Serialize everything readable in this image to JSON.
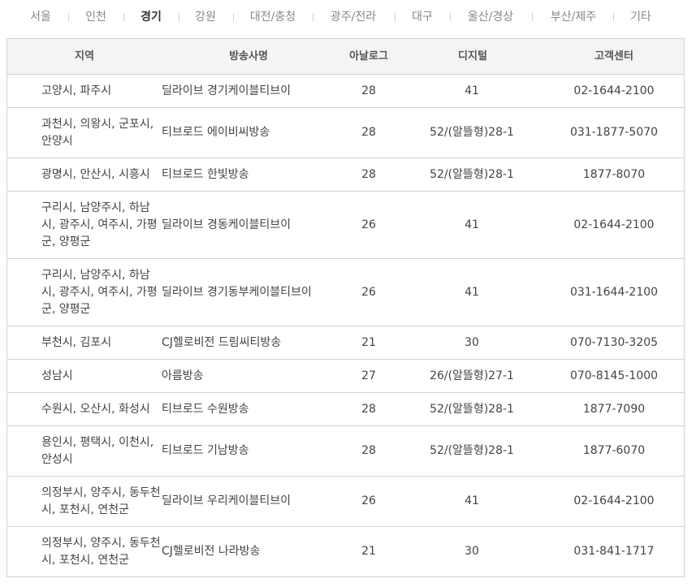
{
  "tabs": [
    {
      "label": "서울",
      "active": false
    },
    {
      "label": "인천",
      "active": false
    },
    {
      "label": "경기",
      "active": true
    },
    {
      "label": "강원",
      "active": false
    },
    {
      "label": "대전/충청",
      "active": false
    },
    {
      "label": "광주/전라",
      "active": false
    },
    {
      "label": "대구",
      "active": false
    },
    {
      "label": "울산/경상",
      "active": false
    },
    {
      "label": "부산/제주",
      "active": false
    },
    {
      "label": "기타",
      "active": false
    }
  ],
  "table": {
    "headers": {
      "region": "지역",
      "broadcaster": "방송사명",
      "analog": "아날로그",
      "digital": "디지털",
      "service_center": "고객센터"
    },
    "rows": [
      {
        "region": "고양시, 파주시",
        "broadcaster": "딜라이브 경기케이블티브이",
        "analog": "28",
        "digital": "41",
        "service_center": "02-1644-2100"
      },
      {
        "region": "과천시, 의왕시, 군포시, 안양시",
        "broadcaster": "티브로드 에이비씨방송",
        "analog": "28",
        "digital": "52/(알뜰형)28-1",
        "service_center": "031-1877-5070"
      },
      {
        "region": "광명시, 안산시, 시흥시",
        "broadcaster": "티브로드 한빛방송",
        "analog": "28",
        "digital": "52/(알뜰형)28-1",
        "service_center": "1877-8070"
      },
      {
        "region": "구리시, 남양주시, 하남시, 광주시, 여주시, 가평군, 양평군",
        "broadcaster": "딜라이브 경동케이블티브이",
        "analog": "26",
        "digital": "41",
        "service_center": "02-1644-2100"
      },
      {
        "region": "구리시, 남양주시, 하남시, 광주시, 여주시, 가평군, 양평군",
        "broadcaster": "딜라이브 경기동부케이블티브이",
        "analog": "26",
        "digital": "41",
        "service_center": "031-1644-2100"
      },
      {
        "region": "부천시, 김포시",
        "broadcaster": "CJ헬로비전 드림씨티방송",
        "analog": "21",
        "digital": "30",
        "service_center": "070-7130-3205"
      },
      {
        "region": "성남시",
        "broadcaster": "아름방송",
        "analog": "27",
        "digital": "26/(알뜰형)27-1",
        "service_center": "070-8145-1000"
      },
      {
        "region": "수원시, 오산시, 화성시",
        "broadcaster": "티브로드 수원방송",
        "analog": "28",
        "digital": "52/(알뜰형)28-1",
        "service_center": "1877-7090"
      },
      {
        "region": "용인시, 평택시, 이천시, 안성시",
        "broadcaster": "티브로드 기남방송",
        "analog": "28",
        "digital": "52/(알뜰형)28-1",
        "service_center": "1877-6070"
      },
      {
        "region": "의정부시, 양주시, 동두천시, 포천시, 연천군",
        "broadcaster": "딜라이브 우리케이블티브이",
        "analog": "26",
        "digital": "41",
        "service_center": "02-1644-2100"
      },
      {
        "region": "의정부시, 양주시, 동두천시, 포천시, 연천군",
        "broadcaster": "CJ헬로비전 나라방송",
        "analog": "21",
        "digital": "30",
        "service_center": "031-841-1717"
      }
    ]
  }
}
